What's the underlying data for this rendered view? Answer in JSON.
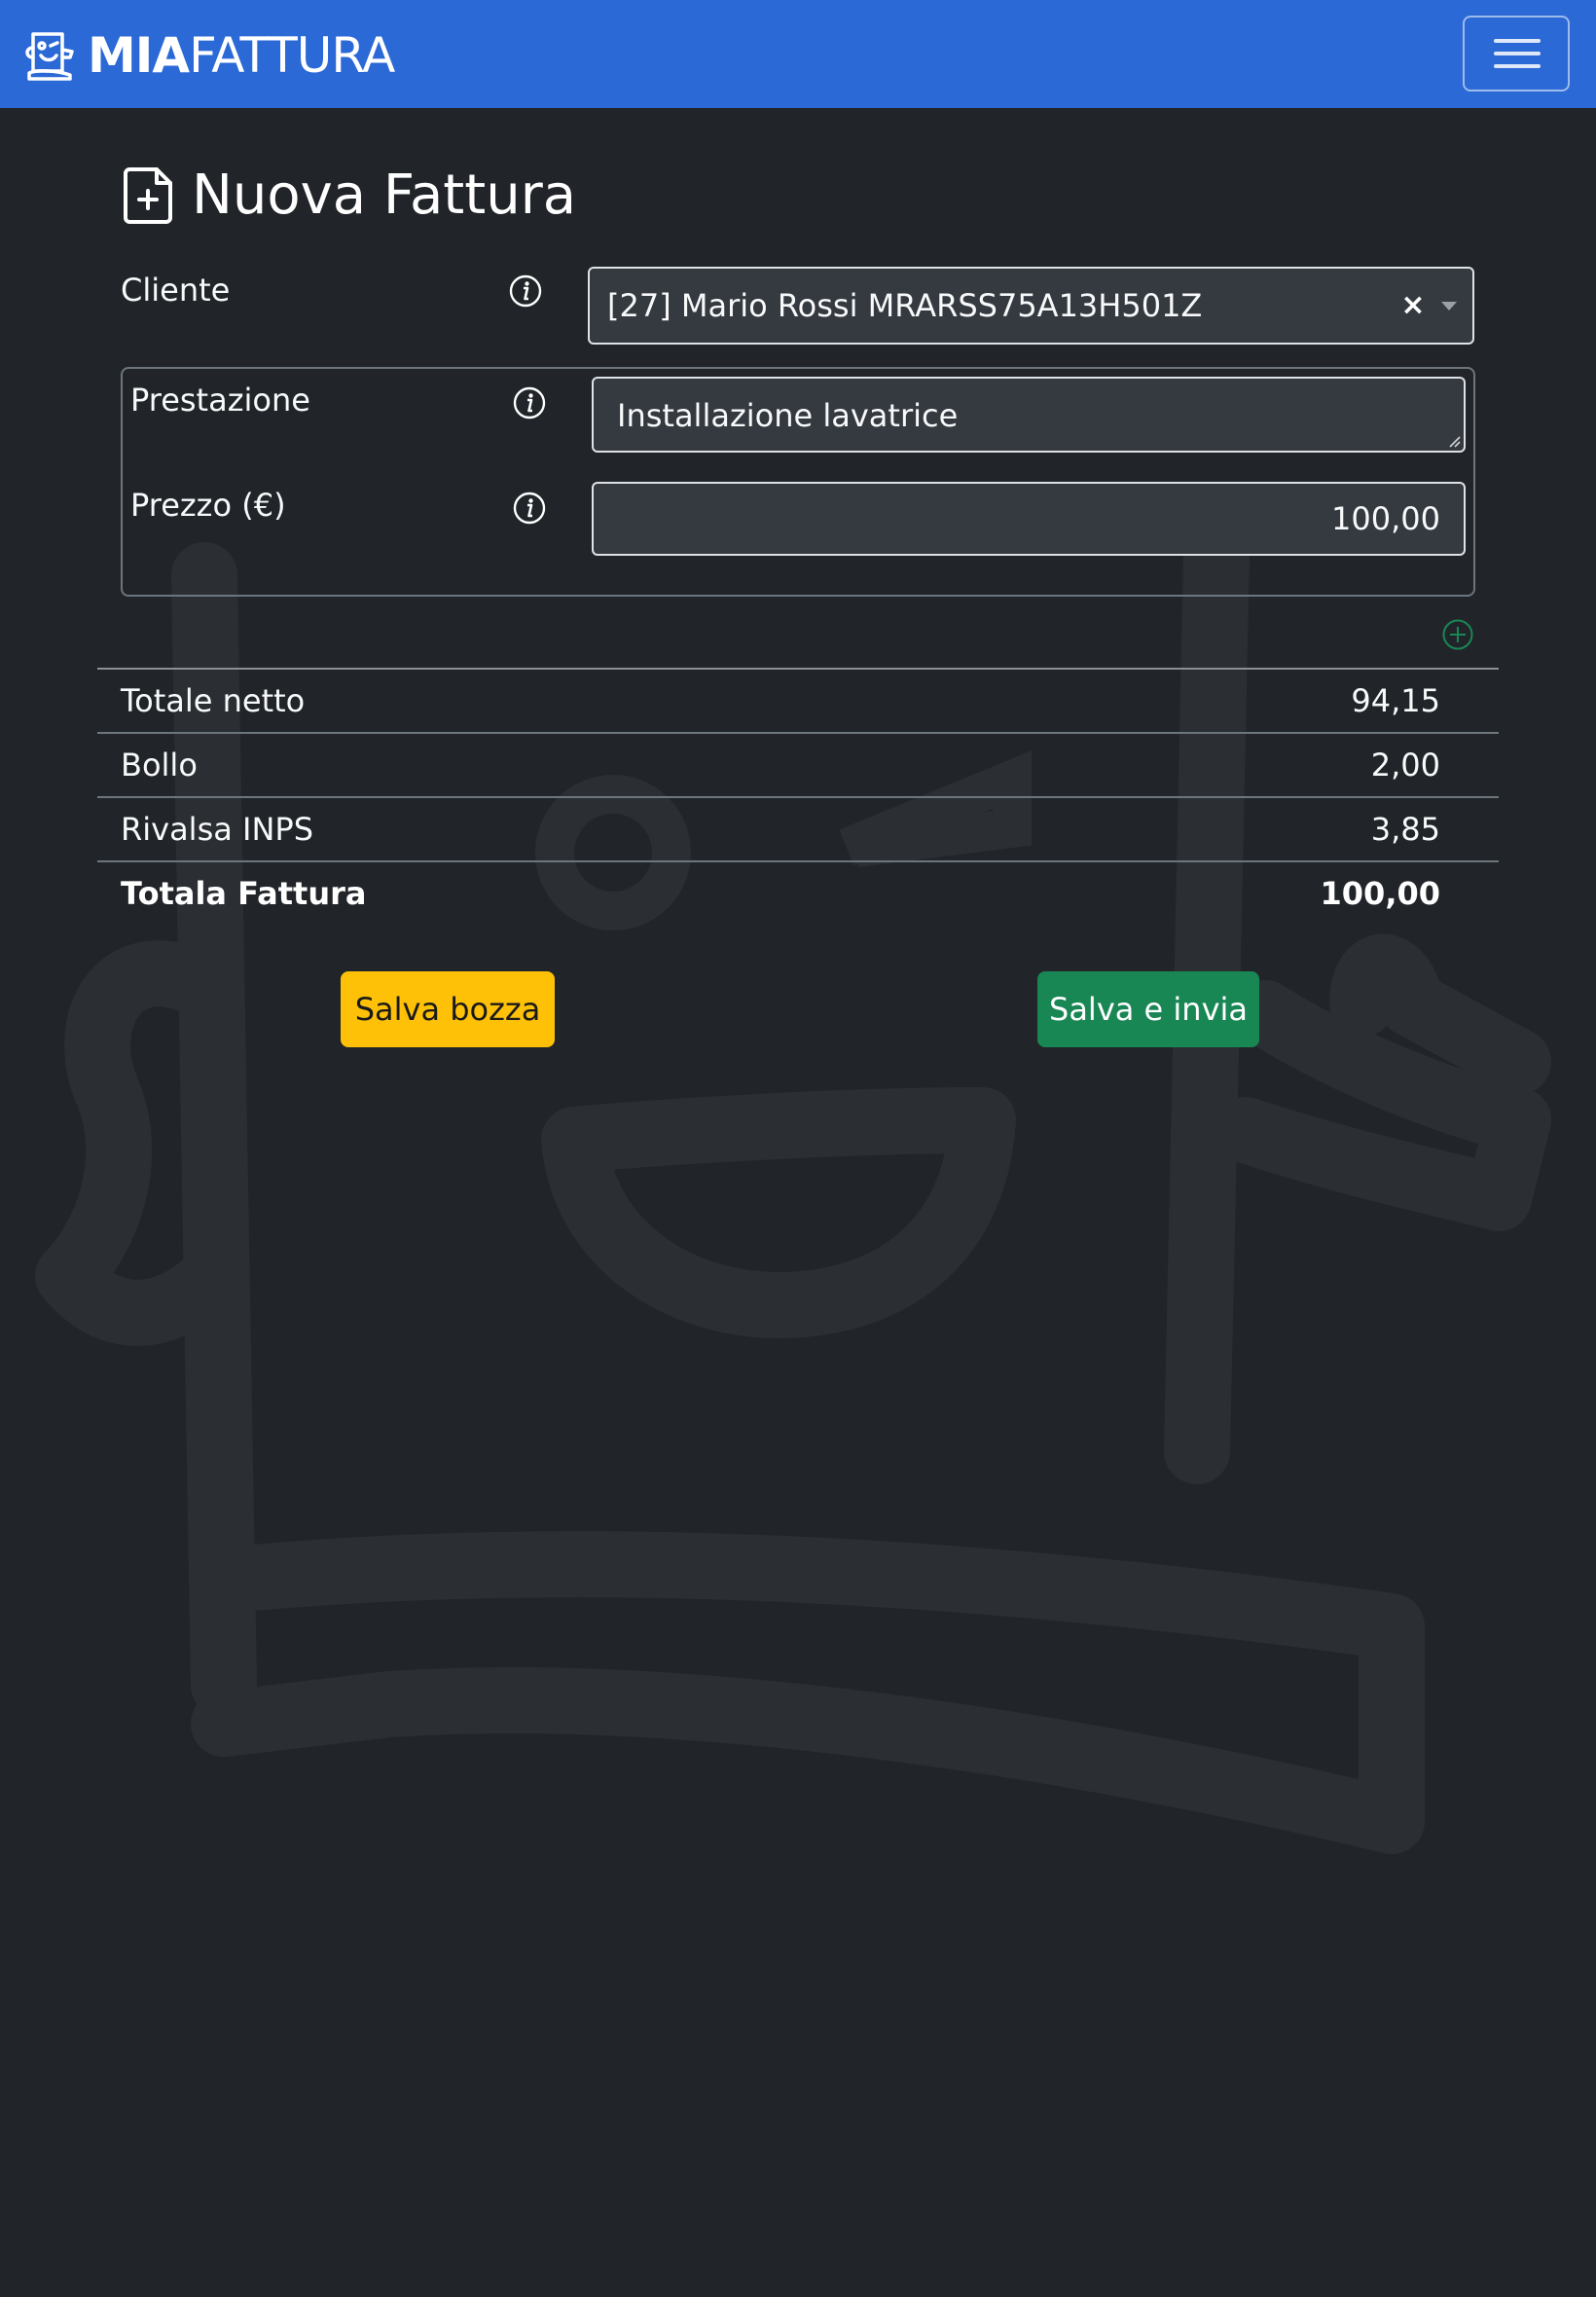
{
  "colors": {
    "navbar": "#2b69d6",
    "background": "#212529",
    "draft_button": "#ffc107",
    "send_button": "#198754",
    "add_icon": "#198754"
  },
  "navbar": {
    "brand_bold": "MIA",
    "brand_light": "FATTURA",
    "logo_icon": "invoice-mascot-logo",
    "menu_icon": "hamburger-menu-icon"
  },
  "page": {
    "title": "Nuova Fattura",
    "title_icon": "file-plus-icon"
  },
  "form": {
    "client": {
      "label": "Cliente",
      "value": "[27] Mario Rossi MRARSS75A13H501Z",
      "clear_symbol": "×",
      "info_icon": "info-circle-icon"
    },
    "line_items": [
      {
        "service_label": "Prestazione",
        "service_value": "Installazione lavatrice",
        "price_label": "Prezzo (€)",
        "price_value": "100,00"
      }
    ],
    "add_line_icon": "plus-circle-icon"
  },
  "totals": [
    {
      "label": "Totale netto",
      "value": "94,15"
    },
    {
      "label": "Bollo",
      "value": "2,00"
    },
    {
      "label": "Rivalsa INPS",
      "value": "3,85"
    },
    {
      "label": "Totala Fattura",
      "value": "100,00"
    }
  ],
  "actions": {
    "draft_label": "Salva bozza",
    "send_label": "Salva e invia"
  }
}
